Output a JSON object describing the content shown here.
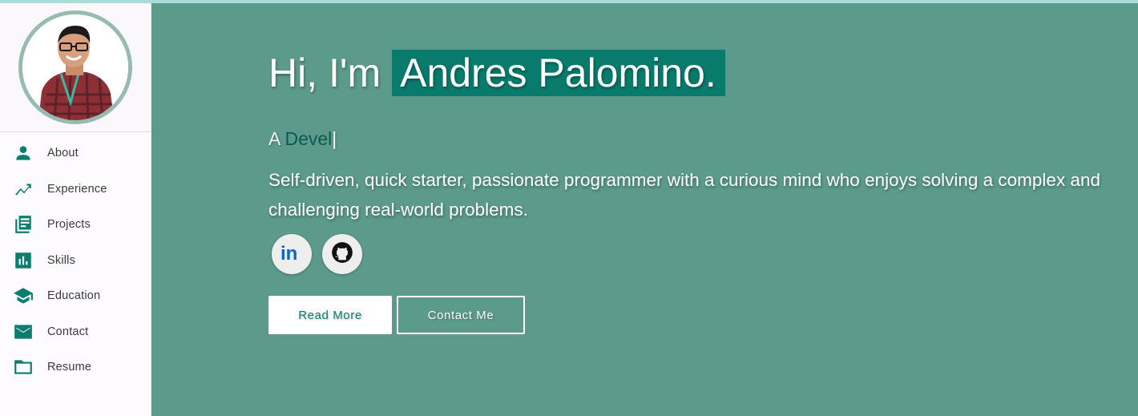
{
  "sidebar": {
    "items": [
      {
        "label": "About",
        "icon": "person-icon"
      },
      {
        "label": "Experience",
        "icon": "trending-up-icon"
      },
      {
        "label": "Projects",
        "icon": "library-books-icon"
      },
      {
        "label": "Skills",
        "icon": "bar-chart-icon"
      },
      {
        "label": "Education",
        "icon": "graduation-cap-icon"
      },
      {
        "label": "Contact",
        "icon": "mail-icon"
      },
      {
        "label": "Resume",
        "icon": "folder-icon"
      }
    ]
  },
  "hero": {
    "greeting": "Hi, I'm",
    "name": "Andres Palomino.",
    "role_prefix": "A",
    "role_typed": "Devel",
    "cursor": "|",
    "bio": "Self-driven, quick starter, passionate programmer with a curious mind who enjoys solving a complex and challenging real-world problems.",
    "socials": [
      {
        "name": "linkedin",
        "label": "in"
      },
      {
        "name": "github",
        "label": ""
      }
    ],
    "buttons": {
      "read_more": "Read More",
      "contact_me": "Contact Me"
    }
  },
  "colors": {
    "accent": "#087b6d",
    "background": "#5c9a8b",
    "sidebar": "#fdfbfd"
  }
}
